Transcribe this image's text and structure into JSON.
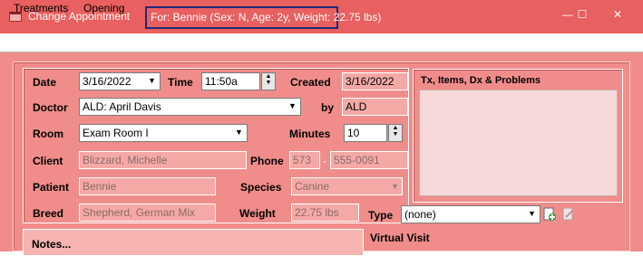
{
  "window": {
    "title": "Change Appointment",
    "patient_banner": "For: Bennie (Sex: N, Age: 2y, Weight: 22.75 lbs)",
    "controls": {
      "minimize": "—",
      "maximize": "☐",
      "close": "✕"
    },
    "accent_color": "#e8605f",
    "banner_border_color": "#1e2a78"
  },
  "menu": {
    "treatments": "Treatments",
    "opening": "Opening"
  },
  "form": {
    "date_label": "Date",
    "date_value": "3/16/2022",
    "time_label": "Time",
    "time_value": "11:50a",
    "created_label": "Created",
    "created_value": "3/16/2022",
    "doctor_label": "Doctor",
    "doctor_value": "ALD: April Davis",
    "by_label": "by",
    "by_value": "ALD",
    "room_label": "Room",
    "room_value": "Exam Room I",
    "minutes_label": "Minutes",
    "minutes_value": "10",
    "client_label": "Client",
    "client_value": "Blizzard, Michelle",
    "phone_label": "Phone",
    "phone_area": "573",
    "phone_sep": "-",
    "phone_number": "555-0091",
    "patient_label": "Patient",
    "patient_value": "Bennie",
    "species_label": "Species",
    "species_value": "Canine",
    "breed_label": "Breed",
    "breed_value": "Shepherd, German Mix",
    "weight_label": "Weight",
    "weight_value": "22.75 lbs",
    "type_label": "Type",
    "type_value": "(none)"
  },
  "tx_panel": {
    "title": "Tx, Items, Dx & Problems"
  },
  "bottom": {
    "notes_label": "Notes...",
    "virtual_visit_label": "Virtual Visit"
  },
  "icons": {
    "dropdown": "▼",
    "spin_up": "▲",
    "spin_down": "▼",
    "app": "calendar-icon",
    "type_add": "add-document-icon",
    "type_edit": "edit-document-icon"
  }
}
